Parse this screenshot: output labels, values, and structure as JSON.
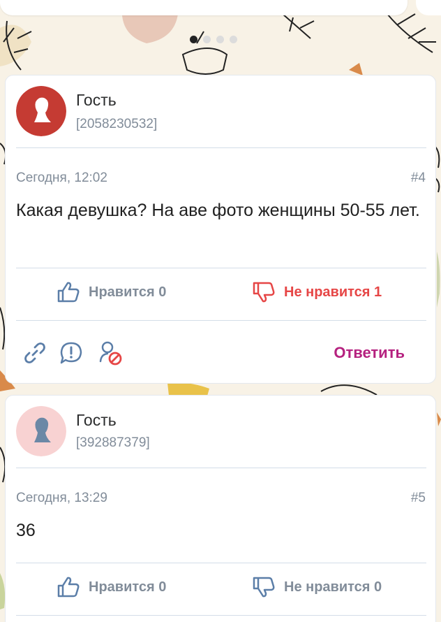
{
  "pager": {
    "total": 4,
    "active": 0
  },
  "posts": [
    {
      "author": "Гость",
      "user_id": "[2058230532]",
      "date": "Сегодня, 12:02",
      "number": "#4",
      "text": "Какая девушка? На аве фото женщины 50-55 лет.",
      "like_label": "Нравится 0",
      "dislike_label": "Не нравится 1",
      "reply_label": "Ответить",
      "avatar_style": "red"
    },
    {
      "author": "Гость",
      "user_id": "[392887379]",
      "date": "Сегодня, 13:29",
      "number": "#5",
      "text": "36",
      "like_label": "Нравится 0",
      "dislike_label": "Не нравится 0",
      "avatar_style": "pink"
    }
  ],
  "colors": {
    "accent": "#b5217f",
    "dislike_active": "#e64646",
    "muted_text": "#818c99",
    "icon_blue": "#5b7ea8",
    "avatar_red": "#c53b33",
    "avatar_pink": "#f8d2d2"
  }
}
